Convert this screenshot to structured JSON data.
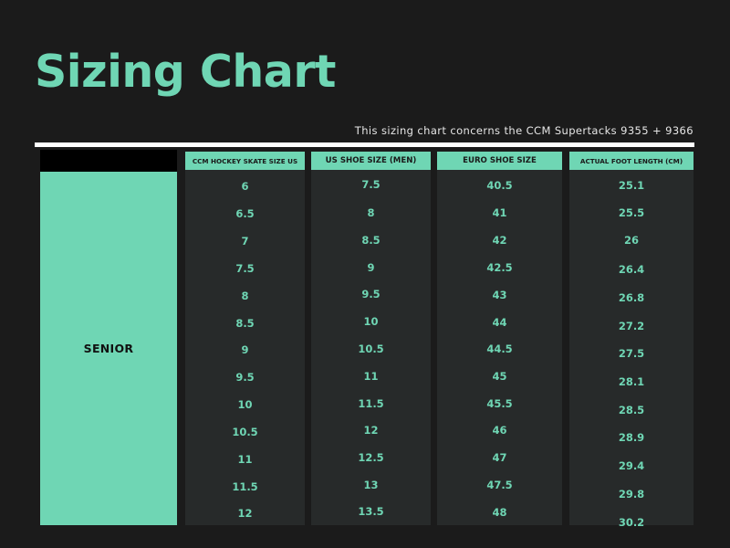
{
  "title": "Sizing Chart",
  "subtitle": "This sizing chart concerns the CCM Supertacks 9355 + 9366",
  "category": "SENIOR",
  "colors": {
    "accent": "#6fd6b4",
    "background": "#1b1b1b",
    "column_body": "#272a2a",
    "rule": "#ffffff"
  },
  "table": {
    "columns": [
      {
        "header": "CCM HOCKEY SKATE SIZE US",
        "values": [
          "6",
          "6.5",
          "7",
          "7.5",
          "8",
          "8.5",
          "9",
          "9.5",
          "10",
          "10.5",
          "11",
          "11.5",
          "12"
        ]
      },
      {
        "header": "US SHOE SIZE (MEN)",
        "values": [
          "7.5",
          "8",
          "8.5",
          "9",
          "9.5",
          "10",
          "10.5",
          "11",
          "11.5",
          "12",
          "12.5",
          "13",
          "13.5"
        ]
      },
      {
        "header": "EURO SHOE SIZE",
        "values": [
          "40.5",
          "41",
          "42",
          "42.5",
          "43",
          "44",
          "44.5",
          "45",
          "45.5",
          "46",
          "47",
          "47.5",
          "48"
        ]
      },
      {
        "header": "ACTUAL FOOT LENGTH (CM)",
        "values": [
          "25.1",
          "25.5",
          "26",
          "26.4",
          "26.8",
          "27.2",
          "27.5",
          "28.1",
          "28.5",
          "28.9",
          "29.4",
          "29.8",
          "30.2"
        ]
      }
    ]
  }
}
